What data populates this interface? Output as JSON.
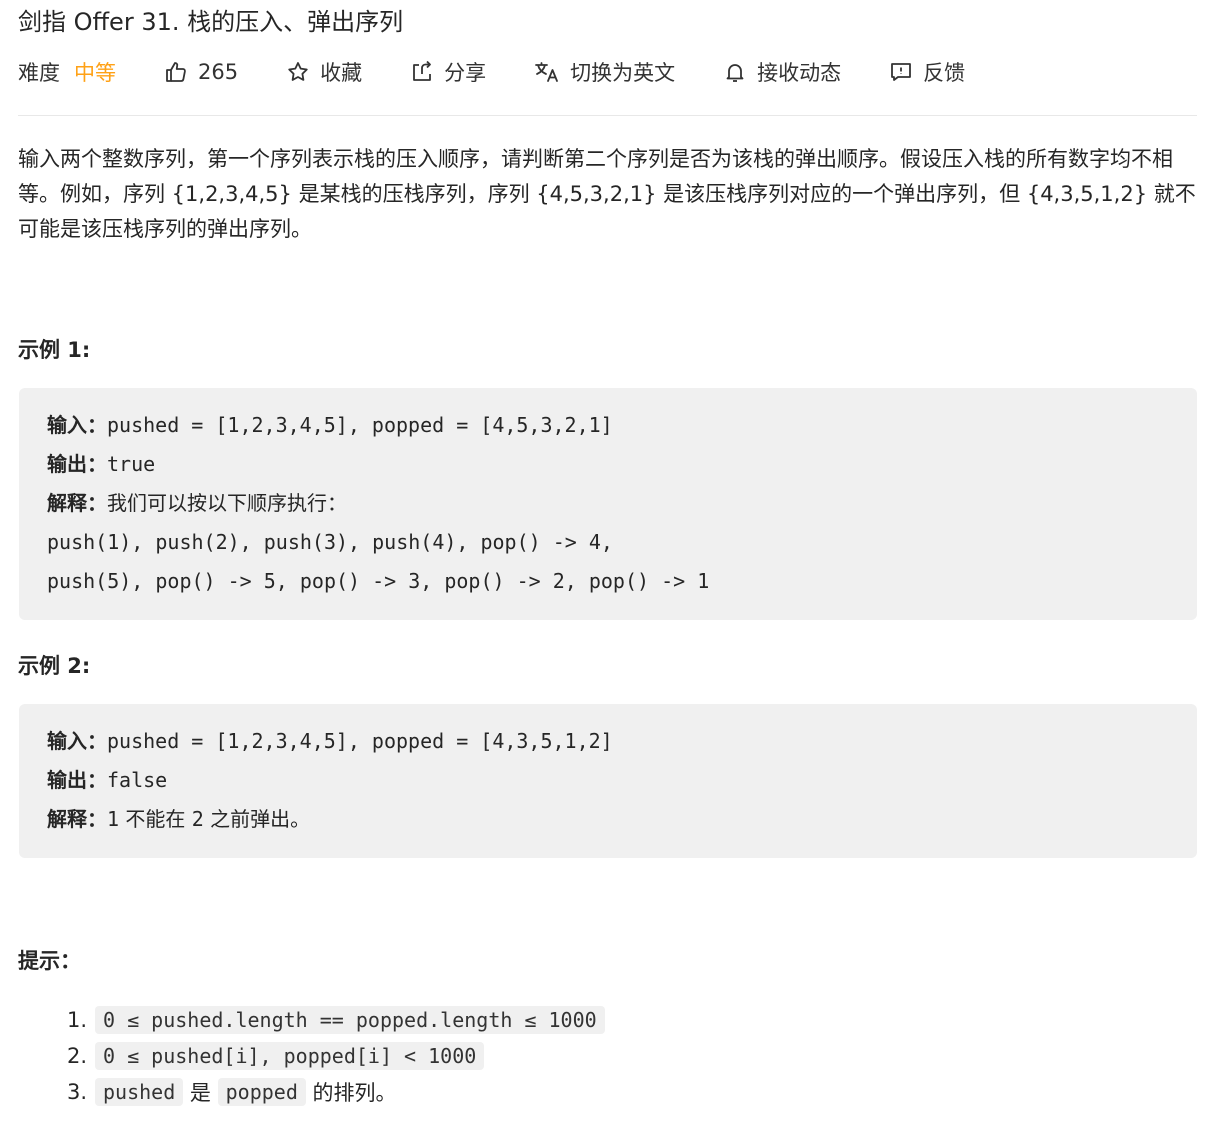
{
  "problem": {
    "title": "剑指 Offer 31. 栈的压入、弹出序列"
  },
  "toolbar": {
    "difficulty_label": "难度",
    "difficulty_value": "中等",
    "difficulty_color": "#ffa116",
    "likes": "265",
    "favorite": "收藏",
    "share": "分享",
    "switch_lang": "切换为英文",
    "subscribe": "接收动态",
    "feedback": "反馈"
  },
  "description": {
    "text": "输入两个整数序列，第一个序列表示栈的压入顺序，请判断第二个序列是否为该栈的弹出顺序。假设压入栈的所有数字均不相等。例如，序列 {1,2,3,4,5} 是某栈的压栈序列，序列 {4,5,3,2,1} 是该压栈序列对应的一个弹出序列，但 {4,3,5,1,2} 就不可能是该压栈序列的弹出序列。"
  },
  "examples": [
    {
      "title": "示例 1:",
      "input_label": "输入：",
      "input": "pushed = [1,2,3,4,5], popped = [4,5,3,2,1]",
      "output_label": "输出：",
      "output": "true",
      "explain_label": "解释：",
      "explain": "我们可以按以下顺序执行：",
      "lines": [
        "push(1), push(2), push(3), push(4), pop() -> 4,",
        "push(5), pop() -> 5, pop() -> 3, pop() -> 2, pop() -> 1"
      ]
    },
    {
      "title": "示例 2:",
      "input_label": "输入：",
      "input": "pushed = [1,2,3,4,5], popped = [4,3,5,1,2]",
      "output_label": "输出：",
      "output": "false",
      "explain_label": "解释：",
      "explain_a": "1",
      "explain_b": " 不能在 ",
      "explain_c": "2",
      "explain_d": " 之前弹出。"
    }
  ],
  "tips": {
    "title": "提示：",
    "items": [
      {
        "num": "1.",
        "code": "0 ≤ pushed.length == popped.length ≤ 1000"
      },
      {
        "num": "2.",
        "code": "0 ≤ pushed[i], popped[i] < 1000"
      },
      {
        "num": "3.",
        "code_a": "pushed",
        "text_a": " 是 ",
        "code_b": "popped",
        "text_b": " 的排列。"
      }
    ]
  },
  "icons": [
    "thumbs-up-icon",
    "star-icon",
    "share-icon",
    "translate-icon",
    "bell-icon",
    "feedback-icon"
  ]
}
